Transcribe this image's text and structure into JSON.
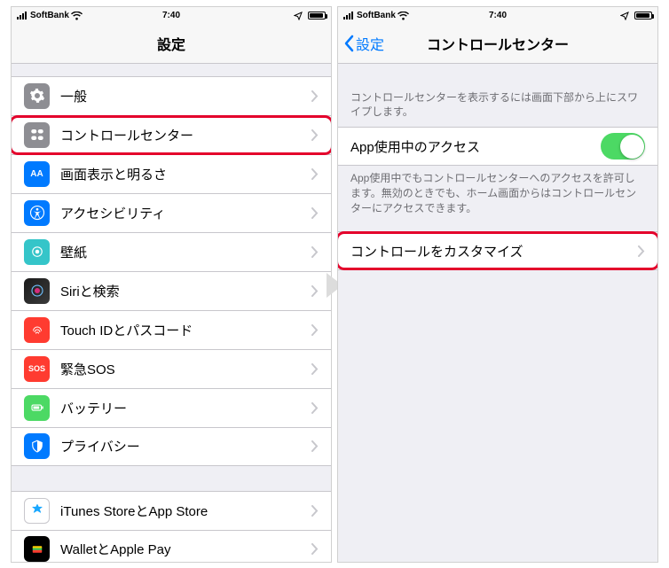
{
  "status": {
    "carrier": "SoftBank",
    "time": "7:40"
  },
  "left": {
    "title": "設定",
    "items": [
      {
        "icon": "general",
        "label": "一般"
      },
      {
        "icon": "control",
        "label": "コントロールセンター",
        "highlight": true
      },
      {
        "icon": "display",
        "label": "画面表示と明るさ"
      },
      {
        "icon": "access",
        "label": "アクセシビリティ"
      },
      {
        "icon": "wall",
        "label": "壁紙"
      },
      {
        "icon": "siri",
        "label": "Siriと検索"
      },
      {
        "icon": "touch",
        "label": "Touch IDとパスコード"
      },
      {
        "icon": "sos",
        "label": "緊急SOS"
      },
      {
        "icon": "battery",
        "label": "バッテリー"
      },
      {
        "icon": "privacy",
        "label": "プライバシー"
      }
    ],
    "group2": [
      {
        "icon": "store",
        "label": "iTunes StoreとApp Store"
      },
      {
        "icon": "wallet",
        "label": "WalletとApple Pay"
      }
    ]
  },
  "right": {
    "back": "設定",
    "title": "コントロールセンター",
    "note1": "コントロールセンターを表示するには画面下部から上にスワイプします。",
    "access_label": "App使用中のアクセス",
    "access_on": true,
    "note2": "App使用中でもコントロールセンターへのアクセスを許可します。無効のときでも、ホーム画面からはコントロールセンターにアクセスできます。",
    "customize": "コントロールをカスタマイズ"
  }
}
